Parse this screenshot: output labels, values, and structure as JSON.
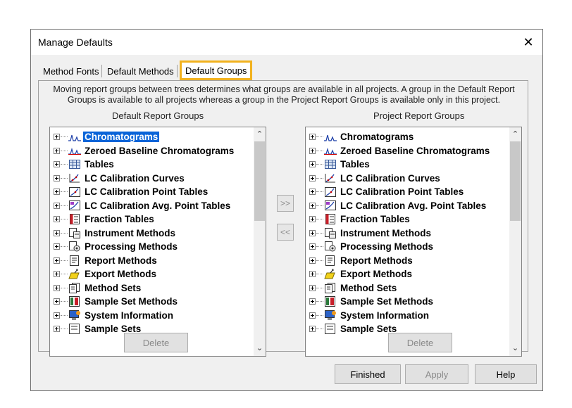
{
  "window": {
    "title": "Manage Defaults",
    "close_glyph": "✕"
  },
  "tabs": [
    {
      "label": "Method Fonts"
    },
    {
      "label": "Default Methods"
    },
    {
      "label": "Default Groups",
      "active": true
    }
  ],
  "description": {
    "line1": "Moving report groups between trees determines what groups are available in all projects. A group in the Default Report",
    "line2": "Groups is available to all projects whereas a group in the Project Report Groups is available only in this project."
  },
  "default_groups": {
    "label": "Default Report Groups",
    "items": [
      {
        "label": "Chromatograms",
        "icon": "chromatogram-icon",
        "selected": true
      },
      {
        "label": "Zeroed Baseline Chromatograms",
        "icon": "zeroed-chromatogram-icon"
      },
      {
        "label": "Tables",
        "icon": "table-icon"
      },
      {
        "label": "LC Calibration Curves",
        "icon": "calibration-curve-icon"
      },
      {
        "label": "LC Calibration Point Tables",
        "icon": "calibration-point-icon"
      },
      {
        "label": "LC Calibration Avg. Point Tables",
        "icon": "calibration-avg-icon"
      },
      {
        "label": "Fraction Tables",
        "icon": "fraction-table-icon"
      },
      {
        "label": "Instrument Methods",
        "icon": "instrument-method-icon"
      },
      {
        "label": "Processing Methods",
        "icon": "processing-method-icon"
      },
      {
        "label": "Report Methods",
        "icon": "report-method-icon"
      },
      {
        "label": "Export Methods",
        "icon": "export-method-icon"
      },
      {
        "label": "Method Sets",
        "icon": "method-set-icon"
      },
      {
        "label": "Sample Set Methods",
        "icon": "sample-set-method-icon"
      },
      {
        "label": "System Information",
        "icon": "system-info-icon"
      },
      {
        "label": "Sample Sets",
        "icon": "sample-set-icon"
      }
    ],
    "delete_label": "Delete"
  },
  "project_groups": {
    "label": "Project Report Groups",
    "items": [
      {
        "label": "Chromatograms",
        "icon": "chromatogram-icon"
      },
      {
        "label": "Zeroed Baseline Chromatograms",
        "icon": "zeroed-chromatogram-icon"
      },
      {
        "label": "Tables",
        "icon": "table-icon"
      },
      {
        "label": "LC Calibration Curves",
        "icon": "calibration-curve-icon"
      },
      {
        "label": "LC Calibration Point Tables",
        "icon": "calibration-point-icon"
      },
      {
        "label": "LC Calibration Avg. Point Tables",
        "icon": "calibration-avg-icon"
      },
      {
        "label": "Fraction Tables",
        "icon": "fraction-table-icon"
      },
      {
        "label": "Instrument Methods",
        "icon": "instrument-method-icon"
      },
      {
        "label": "Processing Methods",
        "icon": "processing-method-icon"
      },
      {
        "label": "Report Methods",
        "icon": "report-method-icon"
      },
      {
        "label": "Export Methods",
        "icon": "export-method-icon"
      },
      {
        "label": "Method Sets",
        "icon": "method-set-icon"
      },
      {
        "label": "Sample Set Methods",
        "icon": "sample-set-method-icon"
      },
      {
        "label": "System Information",
        "icon": "system-info-icon"
      },
      {
        "label": "Sample Sets",
        "icon": "sample-set-icon"
      }
    ],
    "delete_label": "Delete"
  },
  "move_buttons": {
    "right": ">>",
    "left": "<<"
  },
  "footer": {
    "finished": "Finished",
    "apply": "Apply",
    "help": "Help"
  },
  "colors": {
    "selection": "#0a64d8",
    "tab_highlight": "#f2b21f"
  }
}
